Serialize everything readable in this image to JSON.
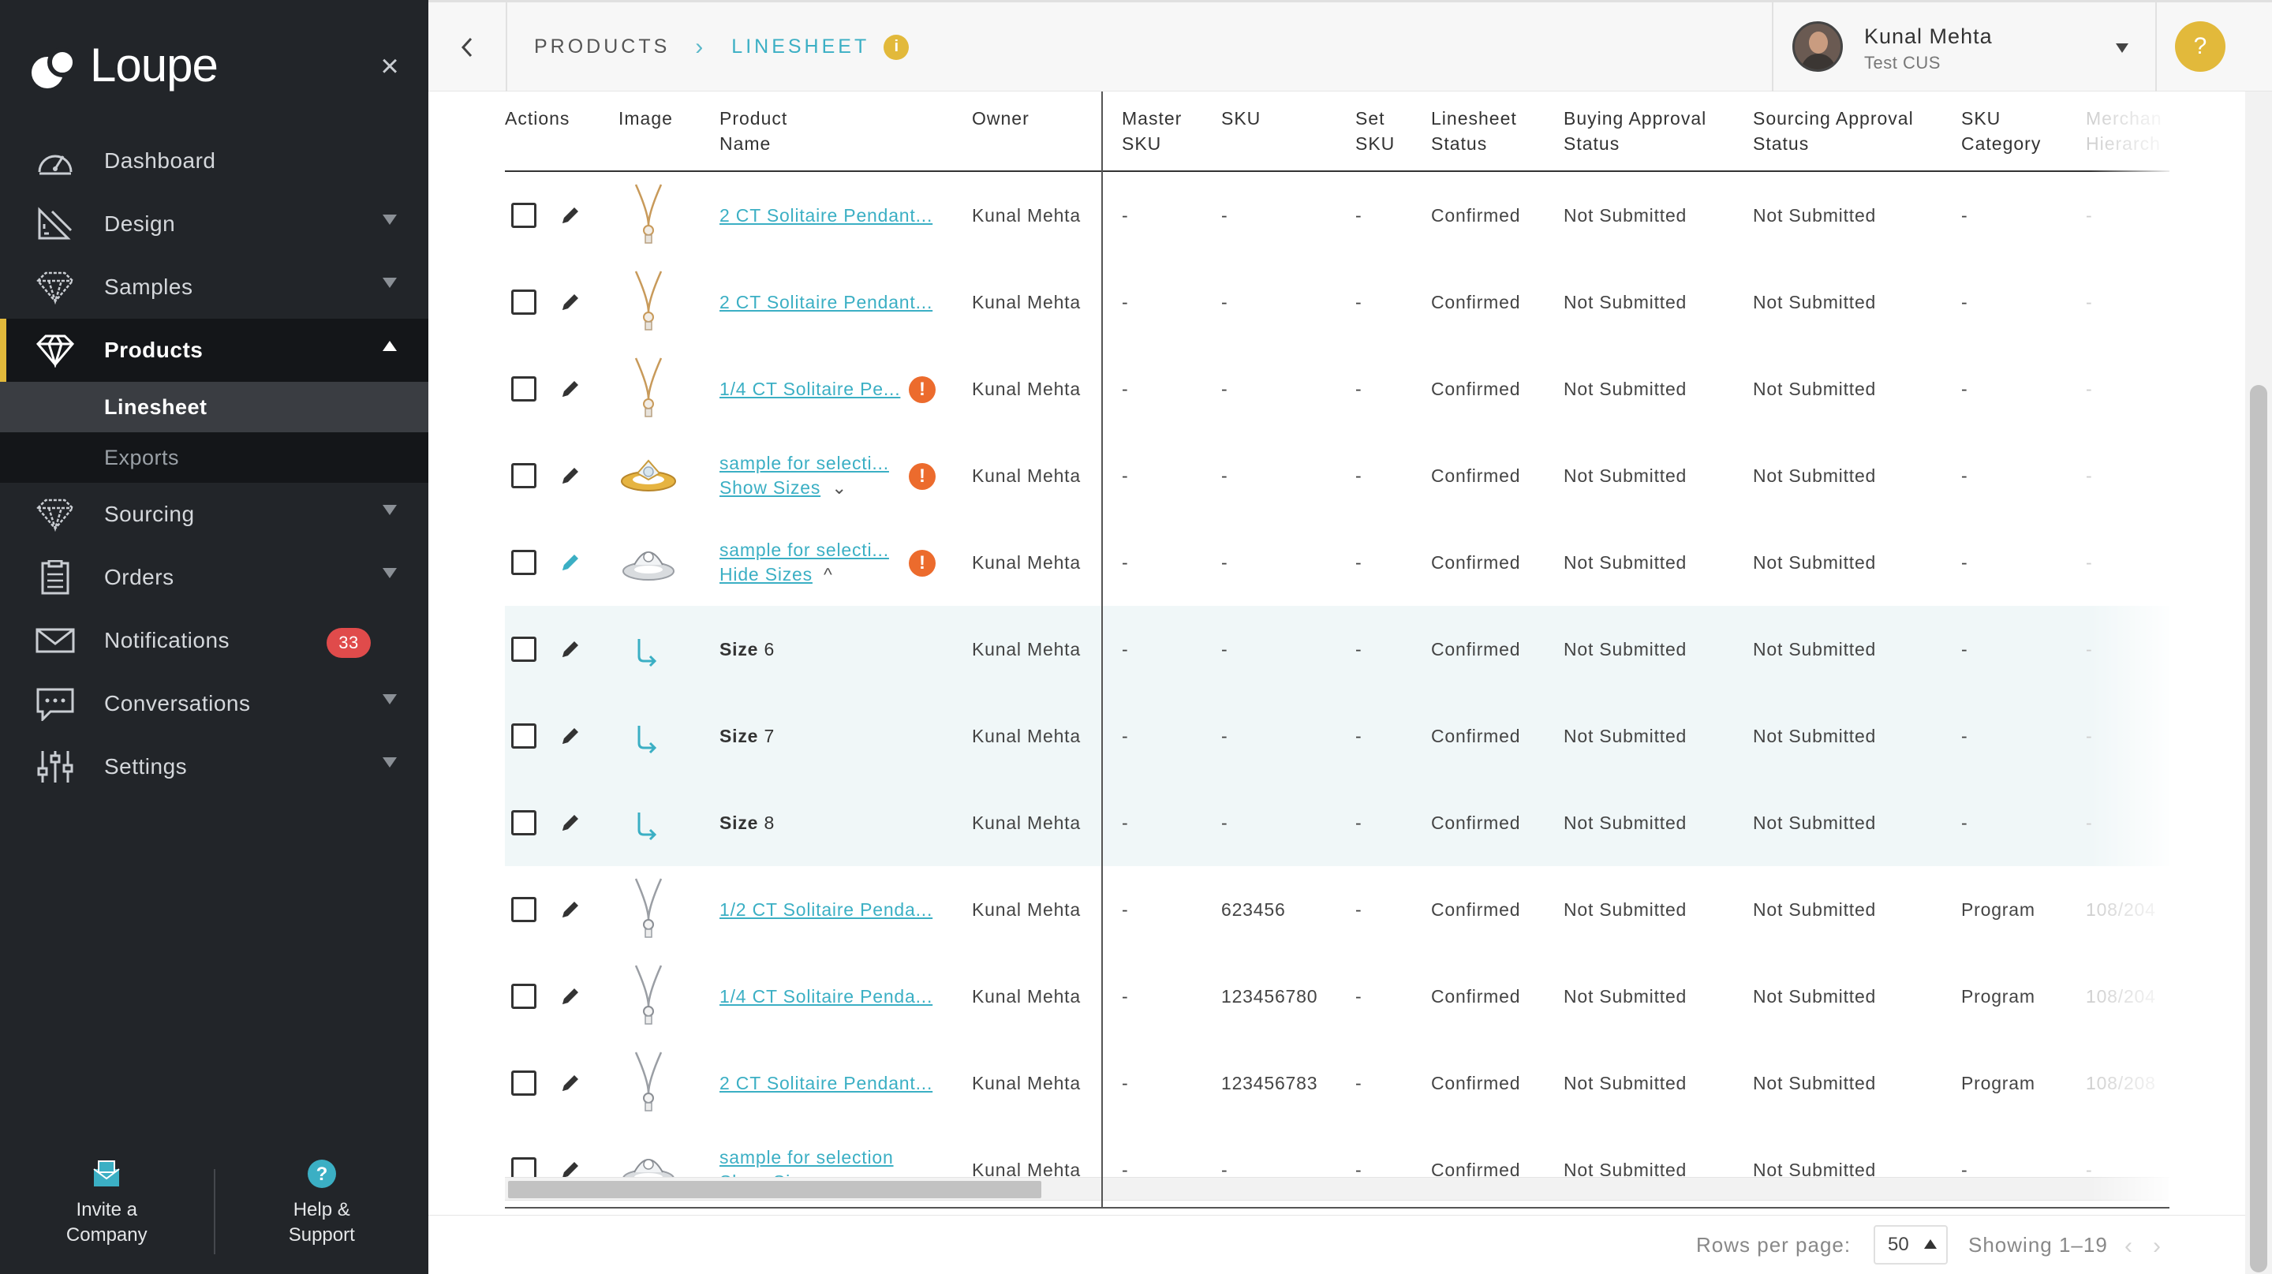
{
  "app": {
    "logo_text": "Loupe"
  },
  "sidebar": {
    "items": [
      {
        "label": "Dashboard",
        "icon": "gauge-icon",
        "has_caret": false
      },
      {
        "label": "Design",
        "icon": "design-tools-icon",
        "has_caret": true
      },
      {
        "label": "Samples",
        "icon": "diamond-outline-icon",
        "has_caret": true
      },
      {
        "label": "Products",
        "icon": "diamond-icon",
        "has_caret": true,
        "active": true
      },
      {
        "label": "Sourcing",
        "icon": "diamond-outline-icon",
        "has_caret": true
      },
      {
        "label": "Orders",
        "icon": "clipboard-icon",
        "has_caret": true
      },
      {
        "label": "Notifications",
        "icon": "envelope-icon",
        "badge": "33"
      },
      {
        "label": "Conversations",
        "icon": "chat-icon",
        "has_caret": true
      },
      {
        "label": "Settings",
        "icon": "sliders-icon",
        "has_caret": true
      }
    ],
    "subitems": [
      {
        "label": "Linesheet",
        "active": true
      },
      {
        "label": "Exports"
      }
    ],
    "footer": {
      "invite_line1": "Invite a",
      "invite_line2": "Company",
      "help_line1": "Help &",
      "help_line2": "Support"
    }
  },
  "header": {
    "breadcrumb_root": "PRODUCTS",
    "breadcrumb_current": "LINESHEET",
    "info_glyph": "i",
    "user_name": "Kunal Mehta",
    "user_company": "Test CUS",
    "help_glyph": "?"
  },
  "table": {
    "columns": {
      "actions": "Actions",
      "image": "Image",
      "product_name_1": "Product",
      "product_name_2": "Name",
      "owner": "Owner",
      "master_sku_1": "Master",
      "master_sku_2": "SKU",
      "sku": "SKU",
      "set_sku_1": "Set",
      "set_sku_2": "SKU",
      "linesheet_status_1": "Linesheet",
      "linesheet_status_2": "Status",
      "buying_status_1": "Buying Approval",
      "buying_status_2": "Status",
      "sourcing_status_1": "Sourcing Approval",
      "sourcing_status_2": "Status",
      "sku_category_1": "SKU",
      "sku_category_2": "Category",
      "merch_1": "Merchan",
      "merch_2": "Hierarch"
    },
    "rows": [
      {
        "type": "product",
        "thumb": "pendant-gold",
        "name": "2 CT Solitaire Pendant...",
        "warn": false,
        "owner": "Kunal Mehta",
        "master_sku": "-",
        "sku": "-",
        "set_sku": "-",
        "linesheet": "Confirmed",
        "buying": "Not Submitted",
        "sourcing": "Not Submitted",
        "category": "-",
        "merch": "-"
      },
      {
        "type": "product",
        "thumb": "pendant-gold",
        "name": "2 CT Solitaire Pendant...",
        "warn": false,
        "owner": "Kunal Mehta",
        "master_sku": "-",
        "sku": "-",
        "set_sku": "-",
        "linesheet": "Confirmed",
        "buying": "Not Submitted",
        "sourcing": "Not Submitted",
        "category": "-",
        "merch": "-"
      },
      {
        "type": "product",
        "thumb": "pendant-gold",
        "name": "1/4 CT Solitaire Pe...",
        "warn": true,
        "owner": "Kunal Mehta",
        "master_sku": "-",
        "sku": "-",
        "set_sku": "-",
        "linesheet": "Confirmed",
        "buying": "Not Submitted",
        "sourcing": "Not Submitted",
        "category": "-",
        "merch": "-"
      },
      {
        "type": "product",
        "thumb": "ring-gold",
        "name": "sample for selecti...",
        "sizes_link": "Show Sizes",
        "sizes_chev": "⌄",
        "warn": true,
        "owner": "Kunal Mehta",
        "master_sku": "-",
        "sku": "-",
        "set_sku": "-",
        "linesheet": "Confirmed",
        "buying": "Not Submitted",
        "sourcing": "Not Submitted",
        "category": "-",
        "merch": "-"
      },
      {
        "type": "product",
        "thumb": "ring-silver",
        "name": "sample for selecti...",
        "sizes_link": "Hide Sizes",
        "sizes_chev": "^",
        "warn": true,
        "pencil_active": true,
        "owner": "Kunal Mehta",
        "master_sku": "-",
        "sku": "-",
        "set_sku": "-",
        "linesheet": "Confirmed",
        "buying": "Not Submitted",
        "sourcing": "Not Submitted",
        "category": "-",
        "merch": "-"
      },
      {
        "type": "size",
        "size_word": "Size",
        "size_num": "6",
        "owner": "Kunal Mehta",
        "master_sku": "-",
        "sku": "-",
        "set_sku": "-",
        "linesheet": "Confirmed",
        "buying": "Not Submitted",
        "sourcing": "Not Submitted",
        "category": "-",
        "merch": "-"
      },
      {
        "type": "size",
        "size_word": "Size",
        "size_num": "7",
        "owner": "Kunal Mehta",
        "master_sku": "-",
        "sku": "-",
        "set_sku": "-",
        "linesheet": "Confirmed",
        "buying": "Not Submitted",
        "sourcing": "Not Submitted",
        "category": "-",
        "merch": "-"
      },
      {
        "type": "size",
        "size_word": "Size",
        "size_num": "8",
        "owner": "Kunal Mehta",
        "master_sku": "-",
        "sku": "-",
        "set_sku": "-",
        "linesheet": "Confirmed",
        "buying": "Not Submitted",
        "sourcing": "Not Submitted",
        "category": "-",
        "merch": "-"
      },
      {
        "type": "product",
        "thumb": "pendant-silver",
        "name": "1/2 CT Solitaire Penda...",
        "warn": false,
        "owner": "Kunal Mehta",
        "master_sku": "-",
        "sku": "623456",
        "set_sku": "-",
        "linesheet": "Confirmed",
        "buying": "Not Submitted",
        "sourcing": "Not Submitted",
        "category": "Program",
        "merch": "108/204"
      },
      {
        "type": "product",
        "thumb": "pendant-silver",
        "name": "1/4 CT Solitaire Penda...",
        "warn": false,
        "owner": "Kunal Mehta",
        "master_sku": "-",
        "sku": "123456780",
        "set_sku": "-",
        "linesheet": "Confirmed",
        "buying": "Not Submitted",
        "sourcing": "Not Submitted",
        "category": "Program",
        "merch": "108/204"
      },
      {
        "type": "product",
        "thumb": "pendant-silver",
        "name": "2 CT Solitaire Pendant...",
        "warn": false,
        "owner": "Kunal Mehta",
        "master_sku": "-",
        "sku": "123456783",
        "set_sku": "-",
        "linesheet": "Confirmed",
        "buying": "Not Submitted",
        "sourcing": "Not Submitted",
        "category": "Program",
        "merch": "108/208"
      },
      {
        "type": "product",
        "thumb": "ring-silver",
        "name": "sample for selection",
        "sizes_link": "Show Sizes",
        "sizes_chev": "⌄",
        "warn": false,
        "owner": "Kunal Mehta",
        "master_sku": "-",
        "sku": "-",
        "set_sku": "-",
        "linesheet": "Confirmed",
        "buying": "Not Submitted",
        "sourcing": "Not Submitted",
        "category": "-",
        "merch": "-"
      }
    ]
  },
  "pagination": {
    "rows_per_page_label": "Rows per page:",
    "rows_per_page_value": "50",
    "showing": "Showing 1–19",
    "prev": "‹",
    "next": "›"
  },
  "colors": {
    "sidebar_bg": "#222529",
    "accent_gold": "#e2b93b",
    "link_teal": "#3bafc4",
    "badge_red": "#e04b4b",
    "warn_orange": "#ec6b2d"
  }
}
